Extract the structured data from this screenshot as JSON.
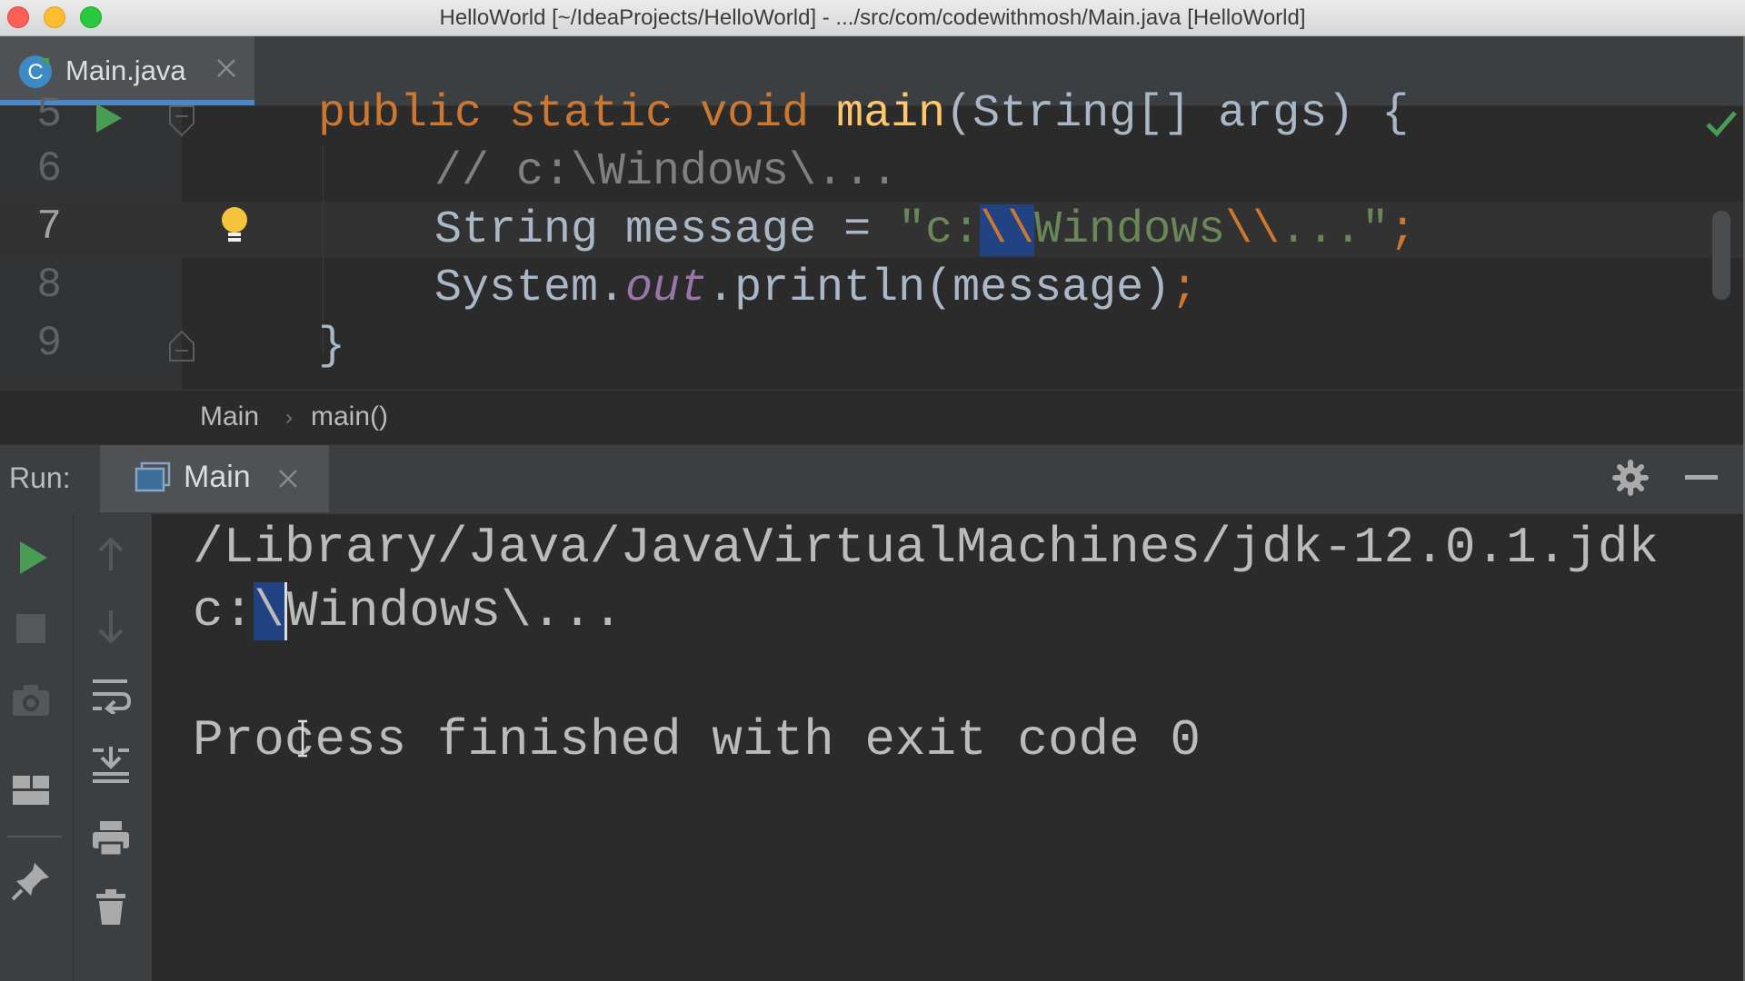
{
  "window": {
    "title": "HelloWorld [~/IdeaProjects/HelloWorld] - .../src/com/codewithmosh/Main.java [HelloWorld]"
  },
  "editor_tabs": [
    {
      "label": "Main.java",
      "icon": "class-icon",
      "icon_letter": "C",
      "active": true
    }
  ],
  "editor": {
    "lines": [
      {
        "number": "5",
        "text": "    public static void main(String[] args) {"
      },
      {
        "number": "6",
        "text": "        // c:\\Windows\\..."
      },
      {
        "number": "7",
        "text": "        String message = \"c:\\\\Windows\\\\...\";"
      },
      {
        "number": "8",
        "text": "        System.out.println(message);"
      },
      {
        "number": "9",
        "text": "    }"
      }
    ],
    "tokens": {
      "kw_public": "public",
      "kw_static": "static",
      "kw_void": "void",
      "fn_main": "main",
      "sig_rest": "(String[] args) {",
      "comment": "// c:\\Windows\\...",
      "l7_type": "String message = ",
      "l7_q1": "\"c:",
      "l7_esc1": "\\\\",
      "l7_mid": "Windows",
      "l7_esc2": "\\\\",
      "l7_tail": "...\"",
      "l7_semi": ";",
      "l8_sys": "System.",
      "l8_out": "out",
      "l8_rest": ".println(message)",
      "l8_semi": ";",
      "l9_brace": "}"
    }
  },
  "breadcrumb": [
    "Main",
    "main()"
  ],
  "run_panel": {
    "label": "Run:",
    "tab_label": "Main",
    "output": {
      "path_line": "/Library/Java/JavaVirtualMachines/jdk-12.0.1.jdk",
      "result_a": "c:",
      "result_sel": "\\",
      "result_b": "Windows\\...",
      "exit_line": "Process finished with exit code 0"
    }
  },
  "colors": {
    "accent_blue": "#4a88c7",
    "run_green": "#499c54",
    "bulb_yellow": "#f5c43c"
  }
}
